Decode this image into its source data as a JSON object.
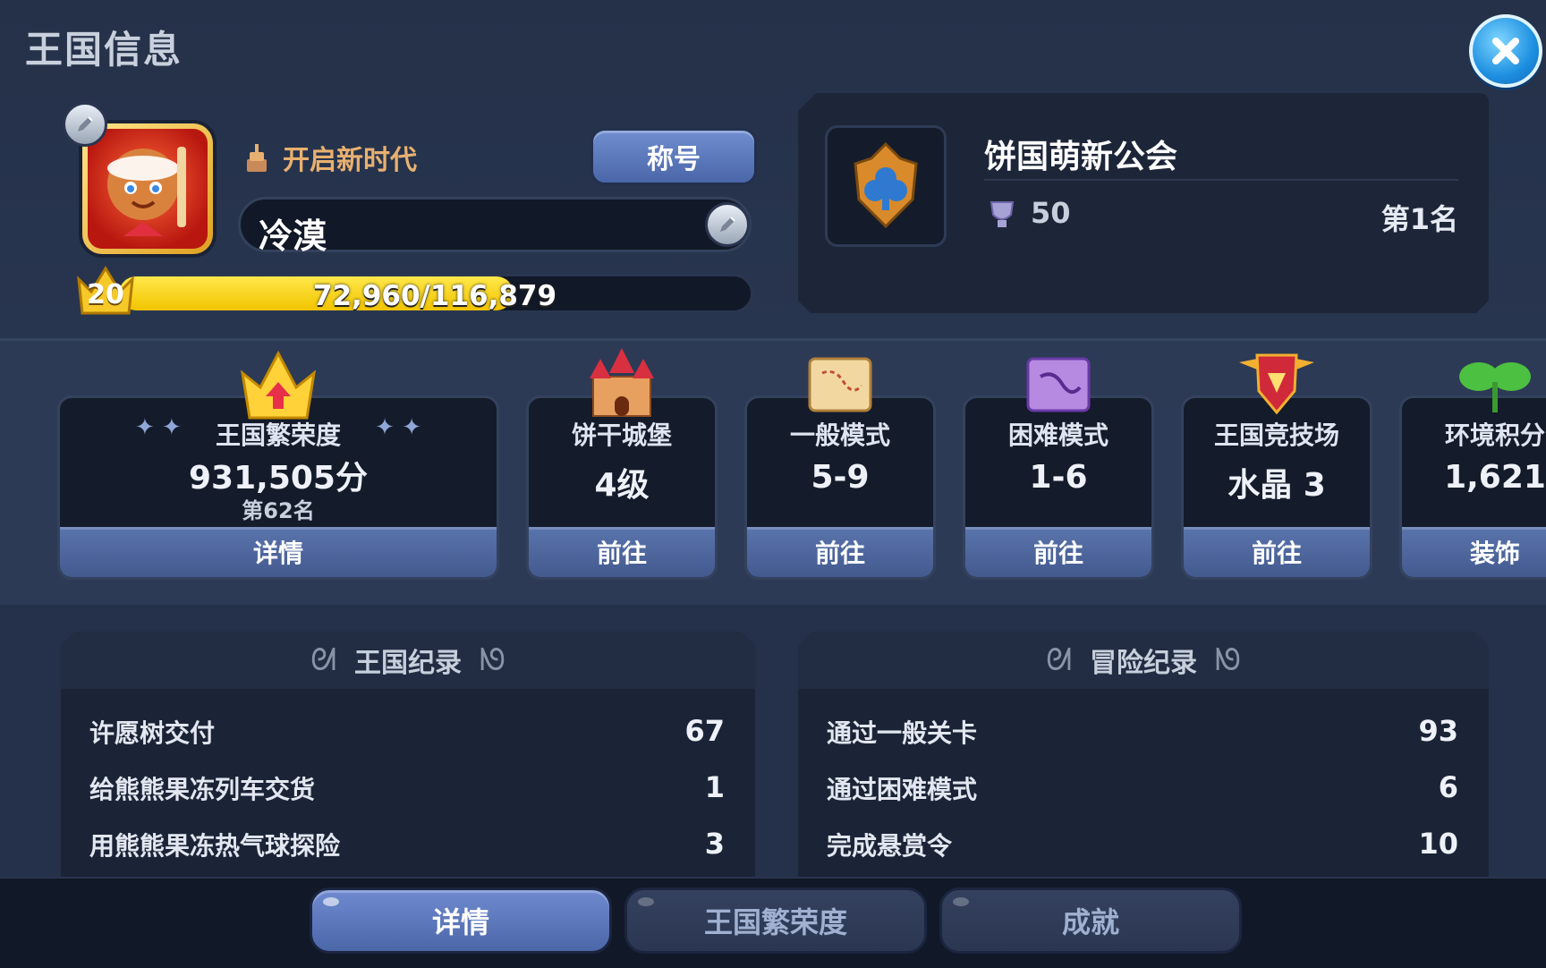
{
  "header": {
    "title": "王国信息",
    "close_icon": "close-icon"
  },
  "profile": {
    "era_label": "开启新时代",
    "title_button": "称号",
    "player_name": "冷漠",
    "level": "20",
    "xp_text": "72,960/116,879",
    "xp_fraction": 0.624,
    "xp_color": "#f2c400"
  },
  "guild": {
    "name": "饼国萌新公会",
    "points": "50",
    "rank": "第1名"
  },
  "cards": [
    {
      "icon": "crown-icon",
      "label": "王国繁荣度",
      "value": "931,505分",
      "sub": "第62名",
      "button": "详情"
    },
    {
      "icon": "castle-icon",
      "label": "饼干城堡",
      "value": "4级",
      "button": "前往"
    },
    {
      "icon": "map-icon",
      "label": "一般模式",
      "value": "5-9",
      "button": "前往"
    },
    {
      "icon": "hard-map-icon",
      "label": "困难模式",
      "value": "1-6",
      "button": "前往"
    },
    {
      "icon": "arena-shield-icon",
      "label": "王国竞技场",
      "value": "水晶 3",
      "button": "前往"
    },
    {
      "icon": "sprout-icon",
      "label": "环境积分",
      "value": "1,621",
      "button": "装饰"
    }
  ],
  "kingdom_records": {
    "title": "王国纪录",
    "rows": [
      {
        "label": "许愿树交付",
        "value": "67"
      },
      {
        "label": "给熊熊果冻列车交货",
        "value": "1"
      },
      {
        "label": "用熊熊果冻热气球探险",
        "value": "3"
      }
    ]
  },
  "adventure_records": {
    "title": "冒险纪录",
    "rows": [
      {
        "label": "通过一般关卡",
        "value": "93"
      },
      {
        "label": "通过困难模式",
        "value": "6"
      },
      {
        "label": "完成悬赏令",
        "value": "10"
      }
    ]
  },
  "tabs": [
    {
      "label": "详情",
      "active": true
    },
    {
      "label": "王国繁荣度",
      "active": false
    },
    {
      "label": "成就",
      "active": false
    }
  ]
}
